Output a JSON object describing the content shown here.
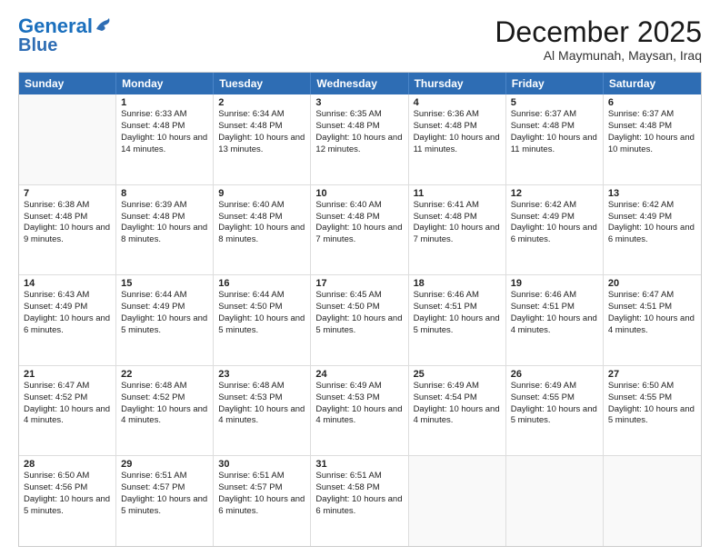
{
  "logo": {
    "line1": "General",
    "line2": "Blue"
  },
  "title": "December 2025",
  "location": "Al Maymunah, Maysan, Iraq",
  "days_of_week": [
    "Sunday",
    "Monday",
    "Tuesday",
    "Wednesday",
    "Thursday",
    "Friday",
    "Saturday"
  ],
  "weeks": [
    [
      {
        "day": "",
        "empty": true
      },
      {
        "day": "1",
        "sunrise": "Sunrise: 6:33 AM",
        "sunset": "Sunset: 4:48 PM",
        "daylight": "Daylight: 10 hours and 14 minutes."
      },
      {
        "day": "2",
        "sunrise": "Sunrise: 6:34 AM",
        "sunset": "Sunset: 4:48 PM",
        "daylight": "Daylight: 10 hours and 13 minutes."
      },
      {
        "day": "3",
        "sunrise": "Sunrise: 6:35 AM",
        "sunset": "Sunset: 4:48 PM",
        "daylight": "Daylight: 10 hours and 12 minutes."
      },
      {
        "day": "4",
        "sunrise": "Sunrise: 6:36 AM",
        "sunset": "Sunset: 4:48 PM",
        "daylight": "Daylight: 10 hours and 11 minutes."
      },
      {
        "day": "5",
        "sunrise": "Sunrise: 6:37 AM",
        "sunset": "Sunset: 4:48 PM",
        "daylight": "Daylight: 10 hours and 11 minutes."
      },
      {
        "day": "6",
        "sunrise": "Sunrise: 6:37 AM",
        "sunset": "Sunset: 4:48 PM",
        "daylight": "Daylight: 10 hours and 10 minutes."
      }
    ],
    [
      {
        "day": "7",
        "sunrise": "Sunrise: 6:38 AM",
        "sunset": "Sunset: 4:48 PM",
        "daylight": "Daylight: 10 hours and 9 minutes."
      },
      {
        "day": "8",
        "sunrise": "Sunrise: 6:39 AM",
        "sunset": "Sunset: 4:48 PM",
        "daylight": "Daylight: 10 hours and 8 minutes."
      },
      {
        "day": "9",
        "sunrise": "Sunrise: 6:40 AM",
        "sunset": "Sunset: 4:48 PM",
        "daylight": "Daylight: 10 hours and 8 minutes."
      },
      {
        "day": "10",
        "sunrise": "Sunrise: 6:40 AM",
        "sunset": "Sunset: 4:48 PM",
        "daylight": "Daylight: 10 hours and 7 minutes."
      },
      {
        "day": "11",
        "sunrise": "Sunrise: 6:41 AM",
        "sunset": "Sunset: 4:48 PM",
        "daylight": "Daylight: 10 hours and 7 minutes."
      },
      {
        "day": "12",
        "sunrise": "Sunrise: 6:42 AM",
        "sunset": "Sunset: 4:49 PM",
        "daylight": "Daylight: 10 hours and 6 minutes."
      },
      {
        "day": "13",
        "sunrise": "Sunrise: 6:42 AM",
        "sunset": "Sunset: 4:49 PM",
        "daylight": "Daylight: 10 hours and 6 minutes."
      }
    ],
    [
      {
        "day": "14",
        "sunrise": "Sunrise: 6:43 AM",
        "sunset": "Sunset: 4:49 PM",
        "daylight": "Daylight: 10 hours and 6 minutes."
      },
      {
        "day": "15",
        "sunrise": "Sunrise: 6:44 AM",
        "sunset": "Sunset: 4:49 PM",
        "daylight": "Daylight: 10 hours and 5 minutes."
      },
      {
        "day": "16",
        "sunrise": "Sunrise: 6:44 AM",
        "sunset": "Sunset: 4:50 PM",
        "daylight": "Daylight: 10 hours and 5 minutes."
      },
      {
        "day": "17",
        "sunrise": "Sunrise: 6:45 AM",
        "sunset": "Sunset: 4:50 PM",
        "daylight": "Daylight: 10 hours and 5 minutes."
      },
      {
        "day": "18",
        "sunrise": "Sunrise: 6:46 AM",
        "sunset": "Sunset: 4:51 PM",
        "daylight": "Daylight: 10 hours and 5 minutes."
      },
      {
        "day": "19",
        "sunrise": "Sunrise: 6:46 AM",
        "sunset": "Sunset: 4:51 PM",
        "daylight": "Daylight: 10 hours and 4 minutes."
      },
      {
        "day": "20",
        "sunrise": "Sunrise: 6:47 AM",
        "sunset": "Sunset: 4:51 PM",
        "daylight": "Daylight: 10 hours and 4 minutes."
      }
    ],
    [
      {
        "day": "21",
        "sunrise": "Sunrise: 6:47 AM",
        "sunset": "Sunset: 4:52 PM",
        "daylight": "Daylight: 10 hours and 4 minutes."
      },
      {
        "day": "22",
        "sunrise": "Sunrise: 6:48 AM",
        "sunset": "Sunset: 4:52 PM",
        "daylight": "Daylight: 10 hours and 4 minutes."
      },
      {
        "day": "23",
        "sunrise": "Sunrise: 6:48 AM",
        "sunset": "Sunset: 4:53 PM",
        "daylight": "Daylight: 10 hours and 4 minutes."
      },
      {
        "day": "24",
        "sunrise": "Sunrise: 6:49 AM",
        "sunset": "Sunset: 4:53 PM",
        "daylight": "Daylight: 10 hours and 4 minutes."
      },
      {
        "day": "25",
        "sunrise": "Sunrise: 6:49 AM",
        "sunset": "Sunset: 4:54 PM",
        "daylight": "Daylight: 10 hours and 4 minutes."
      },
      {
        "day": "26",
        "sunrise": "Sunrise: 6:49 AM",
        "sunset": "Sunset: 4:55 PM",
        "daylight": "Daylight: 10 hours and 5 minutes."
      },
      {
        "day": "27",
        "sunrise": "Sunrise: 6:50 AM",
        "sunset": "Sunset: 4:55 PM",
        "daylight": "Daylight: 10 hours and 5 minutes."
      }
    ],
    [
      {
        "day": "28",
        "sunrise": "Sunrise: 6:50 AM",
        "sunset": "Sunset: 4:56 PM",
        "daylight": "Daylight: 10 hours and 5 minutes."
      },
      {
        "day": "29",
        "sunrise": "Sunrise: 6:51 AM",
        "sunset": "Sunset: 4:57 PM",
        "daylight": "Daylight: 10 hours and 5 minutes."
      },
      {
        "day": "30",
        "sunrise": "Sunrise: 6:51 AM",
        "sunset": "Sunset: 4:57 PM",
        "daylight": "Daylight: 10 hours and 6 minutes."
      },
      {
        "day": "31",
        "sunrise": "Sunrise: 6:51 AM",
        "sunset": "Sunset: 4:58 PM",
        "daylight": "Daylight: 10 hours and 6 minutes."
      },
      {
        "day": "",
        "empty": true
      },
      {
        "day": "",
        "empty": true
      },
      {
        "day": "",
        "empty": true
      }
    ]
  ]
}
